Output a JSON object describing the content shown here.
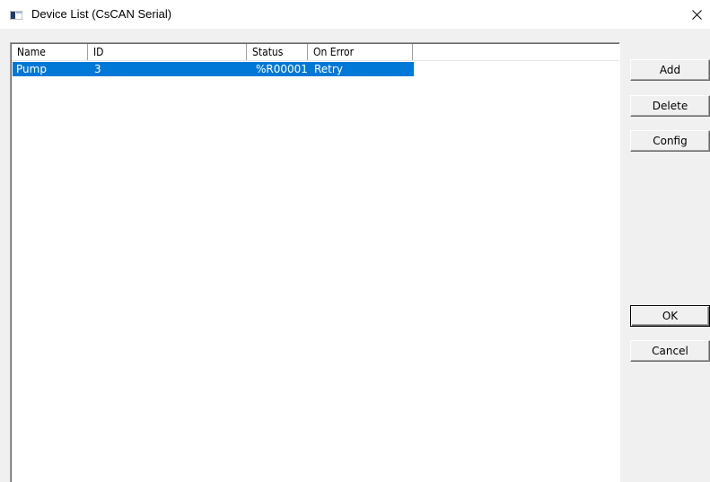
{
  "window": {
    "title": "Device List (CsCAN Serial)",
    "app_icon": "window-app-icon",
    "close_glyph": "×"
  },
  "list": {
    "columns": [
      {
        "label": "Name"
      },
      {
        "label": "ID"
      },
      {
        "label": "Status"
      },
      {
        "label": "On Error"
      }
    ],
    "rows": [
      {
        "name": "Pump",
        "id": "3",
        "status": "%R00001",
        "on_error": "Retry",
        "selected": true
      }
    ]
  },
  "buttons": {
    "add": "Add",
    "delete": "Delete",
    "config": "Config",
    "ok": "OK",
    "cancel": "Cancel"
  },
  "colors": {
    "selection": "#0078d7",
    "window_bg": "#f0f0f0"
  }
}
